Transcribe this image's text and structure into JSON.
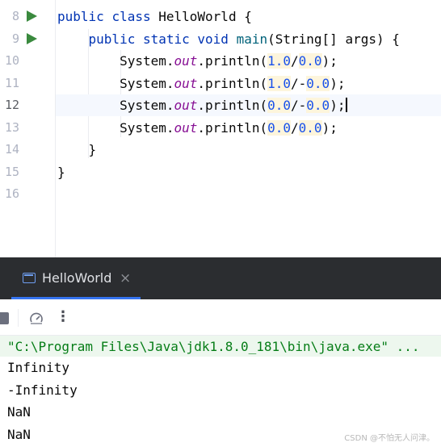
{
  "editor": {
    "lines": [
      {
        "number": "8",
        "tokens": [
          {
            "t": "public",
            "c": "kw"
          },
          {
            "t": " "
          },
          {
            "t": "class",
            "c": "kw"
          },
          {
            "t": " HelloWorld {"
          }
        ],
        "run": true
      },
      {
        "number": "9",
        "tokens": [
          {
            "t": "    "
          },
          {
            "t": "public",
            "c": "kw"
          },
          {
            "t": " "
          },
          {
            "t": "static",
            "c": "kw"
          },
          {
            "t": " "
          },
          {
            "t": "void",
            "c": "kw"
          },
          {
            "t": " "
          },
          {
            "t": "main",
            "c": "fn"
          },
          {
            "t": "(String[] args) {"
          }
        ],
        "run": true
      },
      {
        "number": "10",
        "tokens": [
          {
            "t": "        System."
          },
          {
            "t": "out",
            "c": "static-field"
          },
          {
            "t": ".println("
          },
          {
            "t": "1.0",
            "c": "num hl"
          },
          {
            "t": "/"
          },
          {
            "t": "0.0",
            "c": "num hl"
          },
          {
            "t": ");"
          }
        ]
      },
      {
        "number": "11",
        "tokens": [
          {
            "t": "        System."
          },
          {
            "t": "out",
            "c": "static-field"
          },
          {
            "t": ".println("
          },
          {
            "t": "1.0",
            "c": "num hl"
          },
          {
            "t": "/-"
          },
          {
            "t": "0.0",
            "c": "num hl"
          },
          {
            "t": ");"
          }
        ]
      },
      {
        "number": "12",
        "tokens": [
          {
            "t": "        System."
          },
          {
            "t": "out",
            "c": "static-field"
          },
          {
            "t": ".println("
          },
          {
            "t": "0.0",
            "c": "num hl"
          },
          {
            "t": "/-"
          },
          {
            "t": "0.0",
            "c": "num hl"
          },
          {
            "t": ");"
          }
        ],
        "current": true,
        "caret": true
      },
      {
        "number": "13",
        "tokens": [
          {
            "t": "        System."
          },
          {
            "t": "out",
            "c": "static-field"
          },
          {
            "t": ".println("
          },
          {
            "t": "0.0",
            "c": "num hl"
          },
          {
            "t": "/"
          },
          {
            "t": "0.0",
            "c": "num hl"
          },
          {
            "t": ");"
          }
        ]
      },
      {
        "number": "14",
        "tokens": [
          {
            "t": "    }"
          }
        ]
      },
      {
        "number": "15",
        "tokens": [
          {
            "t": "}"
          }
        ]
      },
      {
        "number": "16",
        "tokens": []
      }
    ]
  },
  "run_panel": {
    "tab_label": "HelloWorld",
    "tab_close": "×",
    "more_actions": "⋮"
  },
  "console": {
    "command": "\"C:\\Program Files\\Java\\jdk1.8.0_181\\bin\\java.exe\" ...",
    "output": [
      "Infinity",
      "-Infinity",
      "NaN",
      "NaN"
    ]
  },
  "watermark": "CSDN @不怕无人问津。",
  "colors": {
    "keyword": "#0033b3",
    "method": "#00627a",
    "static_field": "#871094",
    "number": "#1750eb",
    "run_icon": "#3a8a3e",
    "console_command": "#067d17",
    "tab_accent": "#3574f0"
  },
  "icons": [
    "run-gutter-icon",
    "console-tab-icon",
    "close-icon",
    "stop-icon",
    "gauge-icon",
    "more-vertical-icon"
  ]
}
